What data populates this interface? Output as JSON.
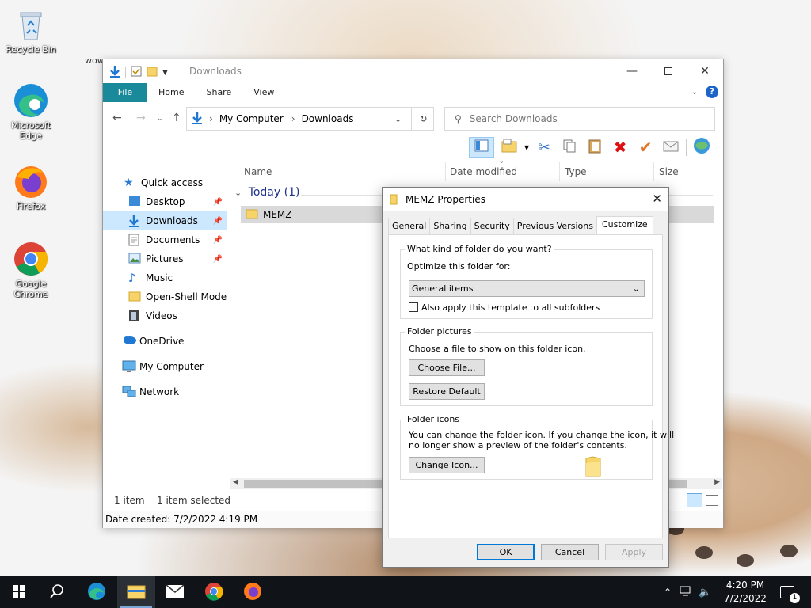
{
  "desktop": {
    "icons": [
      {
        "label": "Recycle Bin"
      },
      {
        "label": "Microsoft Edge"
      },
      {
        "label": "Firefox"
      },
      {
        "label": "Google Chrome"
      }
    ],
    "clipped_text": "wow"
  },
  "explorer": {
    "title": "Downloads",
    "ribbon_tabs": [
      "File",
      "Home",
      "Share",
      "View"
    ],
    "address": {
      "root": "My Computer",
      "current": "Downloads"
    },
    "search_placeholder": "Search Downloads",
    "nav": {
      "quick_access": "Quick access",
      "items": [
        "Desktop",
        "Downloads",
        "Documents",
        "Pictures",
        "Music",
        "Open-Shell Modern",
        "Videos"
      ],
      "onedrive": "OneDrive",
      "my_computer": "My Computer",
      "network": "Network"
    },
    "columns": [
      "Name",
      "Date modified",
      "Type",
      "Size"
    ],
    "group_label": "Today (1)",
    "file": {
      "name": "MEMZ"
    },
    "status": {
      "count": "1 item",
      "selected": "1 item selected",
      "date_created": "Date created: 7/2/2022 4:19 PM"
    }
  },
  "properties": {
    "title": "MEMZ Properties",
    "tabs": [
      "General",
      "Sharing",
      "Security",
      "Previous Versions",
      "Customize"
    ],
    "active_tab": "Customize",
    "kind_group": {
      "label": "What kind of folder do you want?",
      "optimize_label": "Optimize this folder for:",
      "optimize_value": "General items",
      "apply_subfolders": "Also apply this template to all subfolders"
    },
    "pictures_group": {
      "label": "Folder pictures",
      "text": "Choose a file to show on this folder icon.",
      "choose_button": "Choose File...",
      "restore_button": "Restore Default"
    },
    "icons_group": {
      "label": "Folder icons",
      "text_line1": "You can change the folder icon. If you change the icon, it will",
      "text_line2": "no longer show a preview of the folder's contents.",
      "change_button": "Change Icon..."
    },
    "buttons": {
      "ok": "OK",
      "cancel": "Cancel",
      "apply": "Apply"
    }
  },
  "taskbar": {
    "clock_time": "4:20 PM",
    "clock_date": "7/2/2022",
    "notifications": "1"
  },
  "colors": {
    "accent": "#0078d7",
    "file_tab": "#1a8a9a",
    "selection": "#cce8ff",
    "taskbar": "#101318"
  }
}
